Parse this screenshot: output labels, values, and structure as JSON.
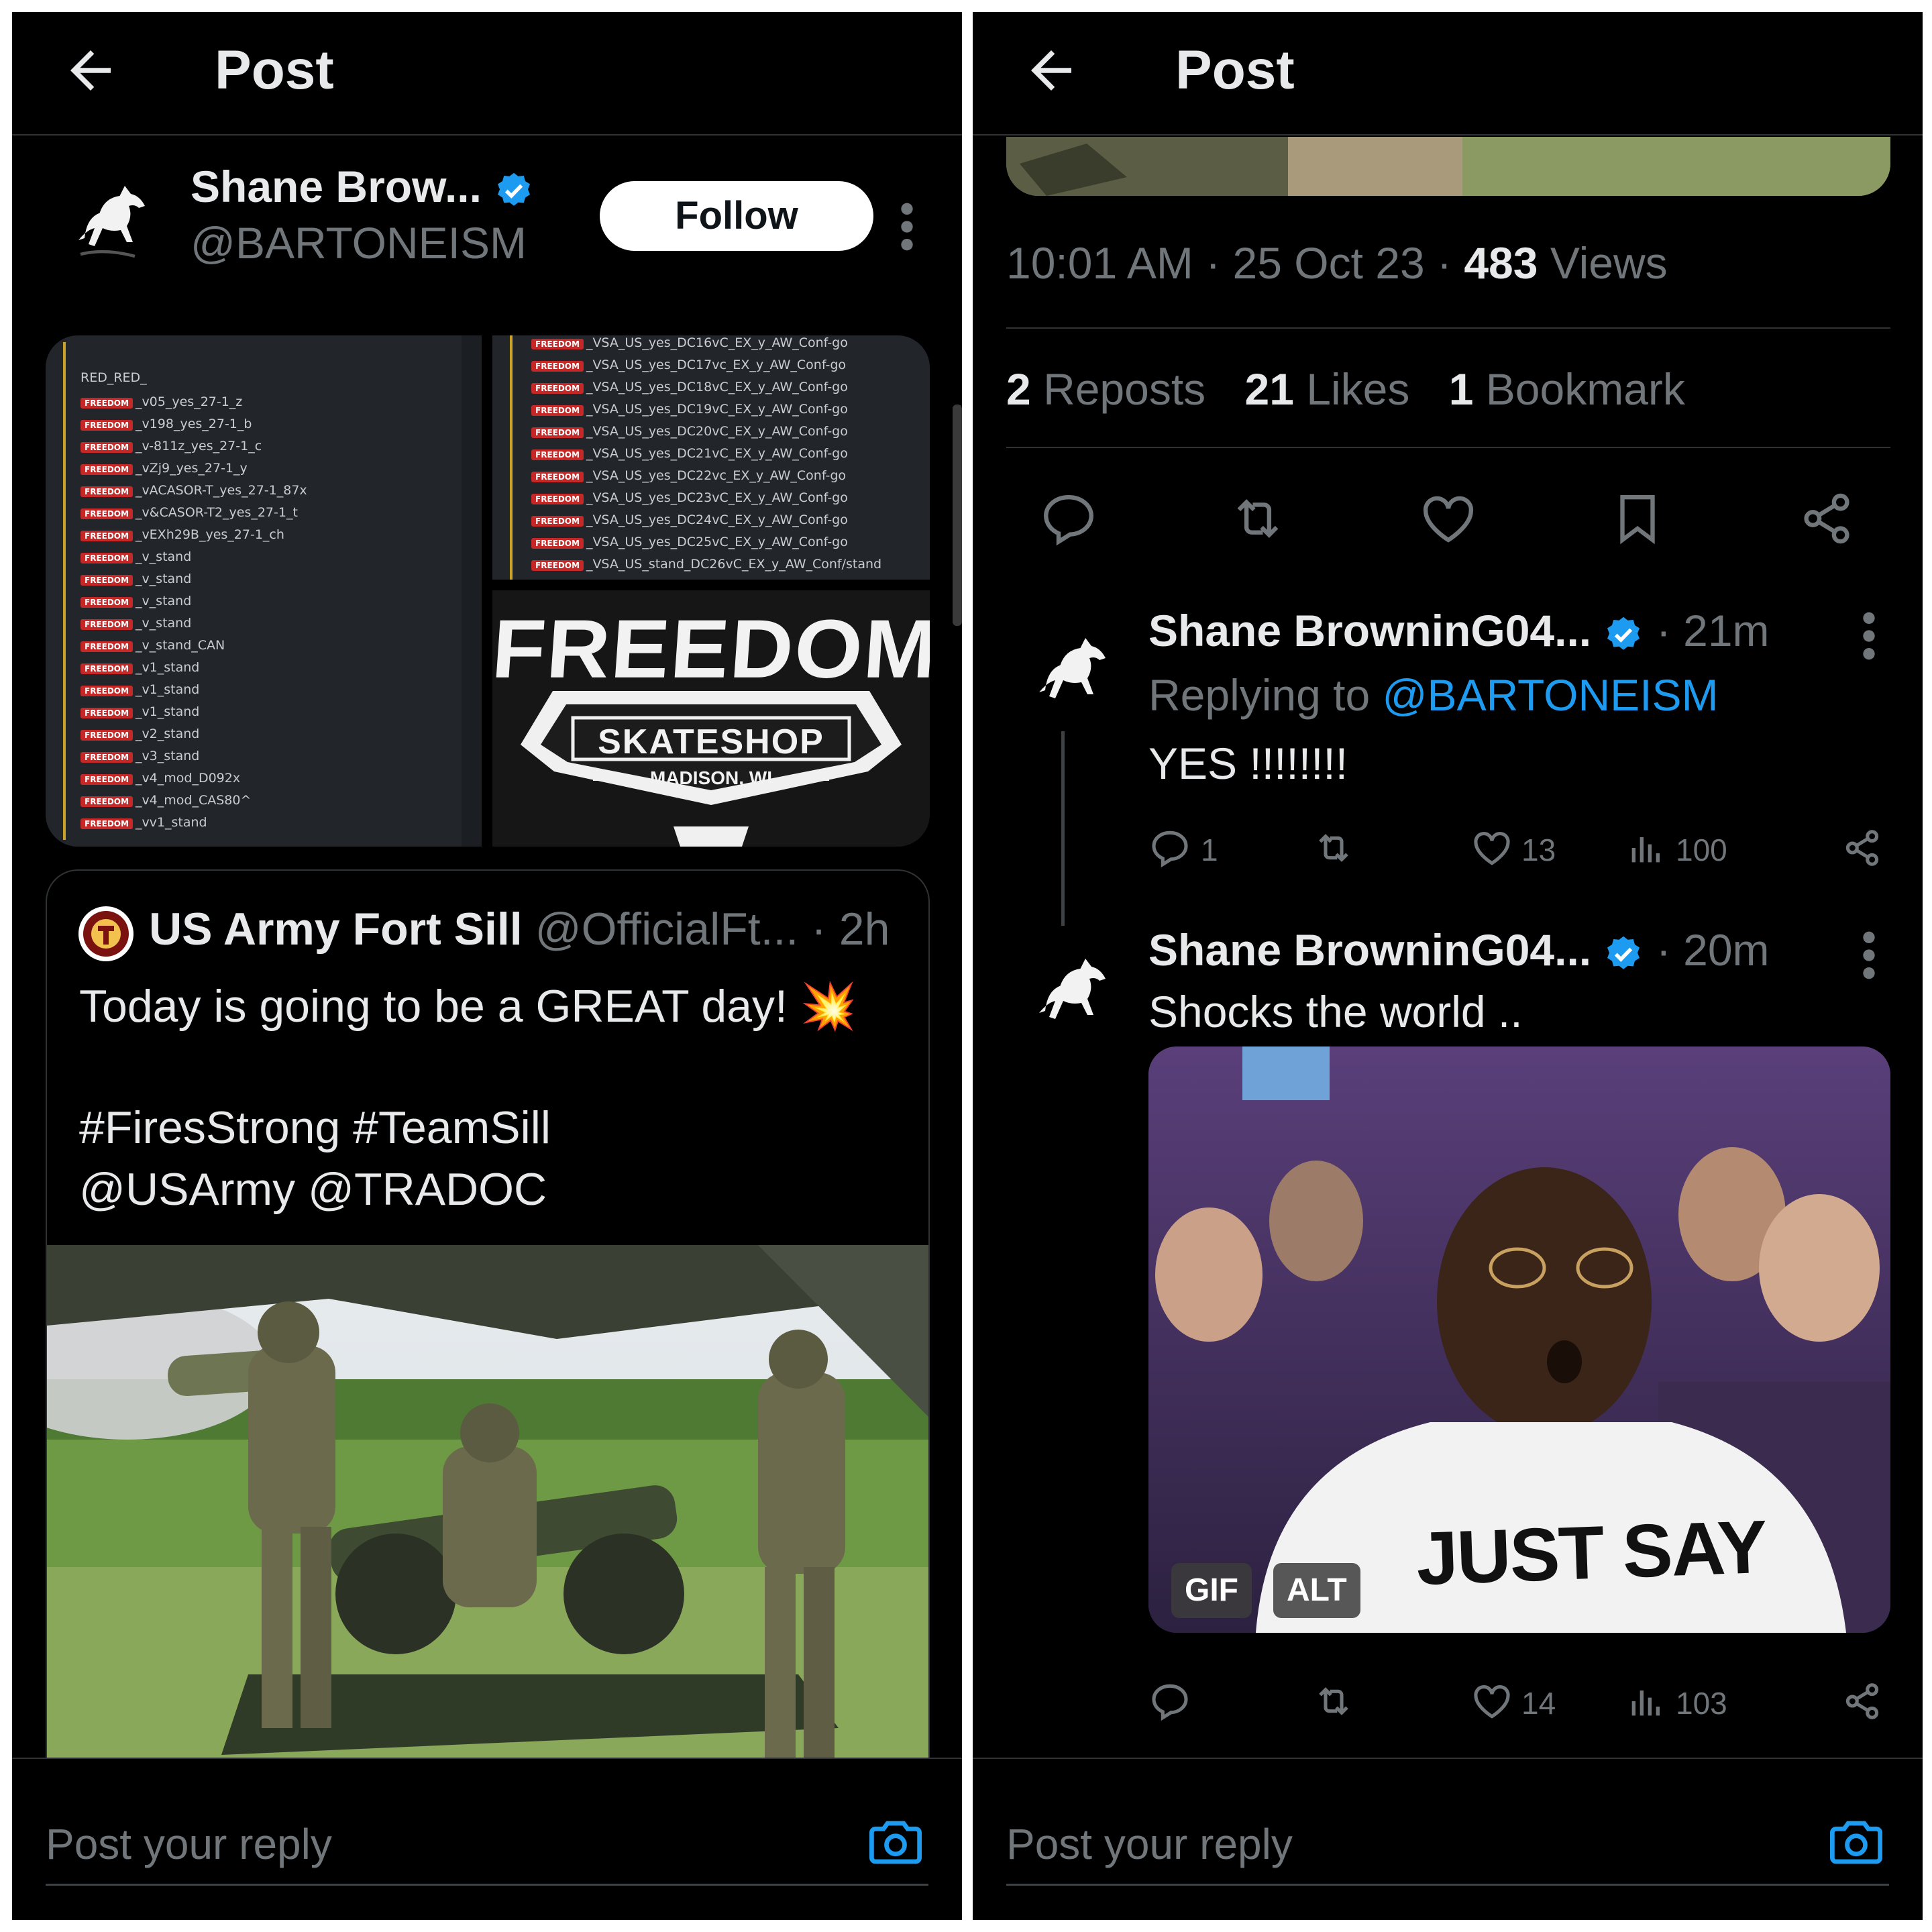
{
  "left": {
    "topbar": {
      "title": "Post"
    },
    "author": {
      "name": "Shane Brow...",
      "handle": "@BARTONEISM",
      "follow_label": "Follow"
    },
    "media": {
      "screenshot_header": "RED_RED_",
      "screenshot_tag": "FREEDOM",
      "screenshot_lines": [
        "_v05_yes_27-1_z",
        "_v198_yes_27-1_b",
        "_v-811z_yes_27-1_c",
        "_vZj9_yes_27-1_y",
        "_vACASOR-T_yes_27-1_87x",
        "_v&CASOR-T2_yes_27-1_t",
        "_vEXh29B_yes_27-1_ch",
        "_v_stand",
        "_v_stand",
        "_v_stand",
        "_v_stand",
        "_v_stand_CAN",
        "_v1_stand",
        "_v1_stand",
        "_v1_stand",
        "_v2_stand",
        "_v3_stand",
        "_v4_mod_D092x",
        "_v4_mod_CAS80^",
        "_vv1_stand"
      ],
      "screenshot2_lines": [
        "_VSA_US_yes_DC16vC_EX_y_AW_Conf-go",
        "_VSA_US_yes_DC17vc_EX_y_AW_Conf-go",
        "_VSA_US_yes_DC18vC_EX_y_AW_Conf-go",
        "_VSA_US_yes_DC19vC_EX_y_AW_Conf-go",
        "_VSA_US_yes_DC20vC_EX_y_AW_Conf-go",
        "_VSA_US_yes_DC21vC_EX_y_AW_Conf-go",
        "_VSA_US_yes_DC22vc_EX_y_AW_Conf-go",
        "_VSA_US_yes_DC23vC_EX_y_AW_Conf-go",
        "_VSA_US_yes_DC24vC_EX_y_AW_Conf-go",
        "_VSA_US_yes_DC25vC_EX_y_AW_Conf-go",
        "_VSA_US_stand_DC26vC_EX_y_AW_Conf/stand"
      ],
      "logo_title": "FREEDOM",
      "logo_subtitle": "SKATESHOP",
      "logo_location": "MADISON, WI"
    },
    "quote": {
      "name": "US Army Fort Sill",
      "handle": "@OfficialFt...",
      "time": "· 2h",
      "text_line1": "Today is going to be a GREAT day! 💥",
      "text_line2": "#FiresStrong #TeamSill",
      "text_line3": "@USArmy @TRADOC"
    },
    "reply_placeholder": "Post your reply"
  },
  "right": {
    "topbar": {
      "title": "Post"
    },
    "meta": {
      "time": "10:01 AM",
      "date": "25 Oct 23",
      "views_count": "483",
      "views_label": "Views"
    },
    "stats": {
      "reposts_count": "2",
      "reposts_label": "Reposts",
      "likes_count": "21",
      "likes_label": "Likes",
      "bookmarks_count": "1",
      "bookmarks_label": "Bookmark"
    },
    "reply1": {
      "name": "Shane BrowninG04...",
      "time": "· 21m",
      "replying_prefix": "Replying to",
      "replying_handle": "@BARTONEISM",
      "text": "YES !!!!!!!!",
      "replies": "1",
      "likes": "13",
      "views": "100"
    },
    "reply2": {
      "name": "Shane BrowninG04...",
      "time": "· 20m",
      "text": "Shocks the world ..",
      "gif_badge": "GIF",
      "alt_badge": "ALT",
      "shirt_text": "JUST SAY",
      "likes": "14",
      "views": "103"
    },
    "reply_placeholder": "Post your reply"
  },
  "colors": {
    "background": "#000000",
    "text": "#e7e9ea",
    "muted": "#71767b",
    "accent": "#1d9bf0",
    "divider": "#2f3336"
  },
  "icons": [
    "back-arrow-icon",
    "verified-icon",
    "more-icon",
    "reply-icon",
    "repost-icon",
    "like-icon",
    "bookmark-icon",
    "share-icon",
    "views-icon",
    "camera-icon"
  ]
}
